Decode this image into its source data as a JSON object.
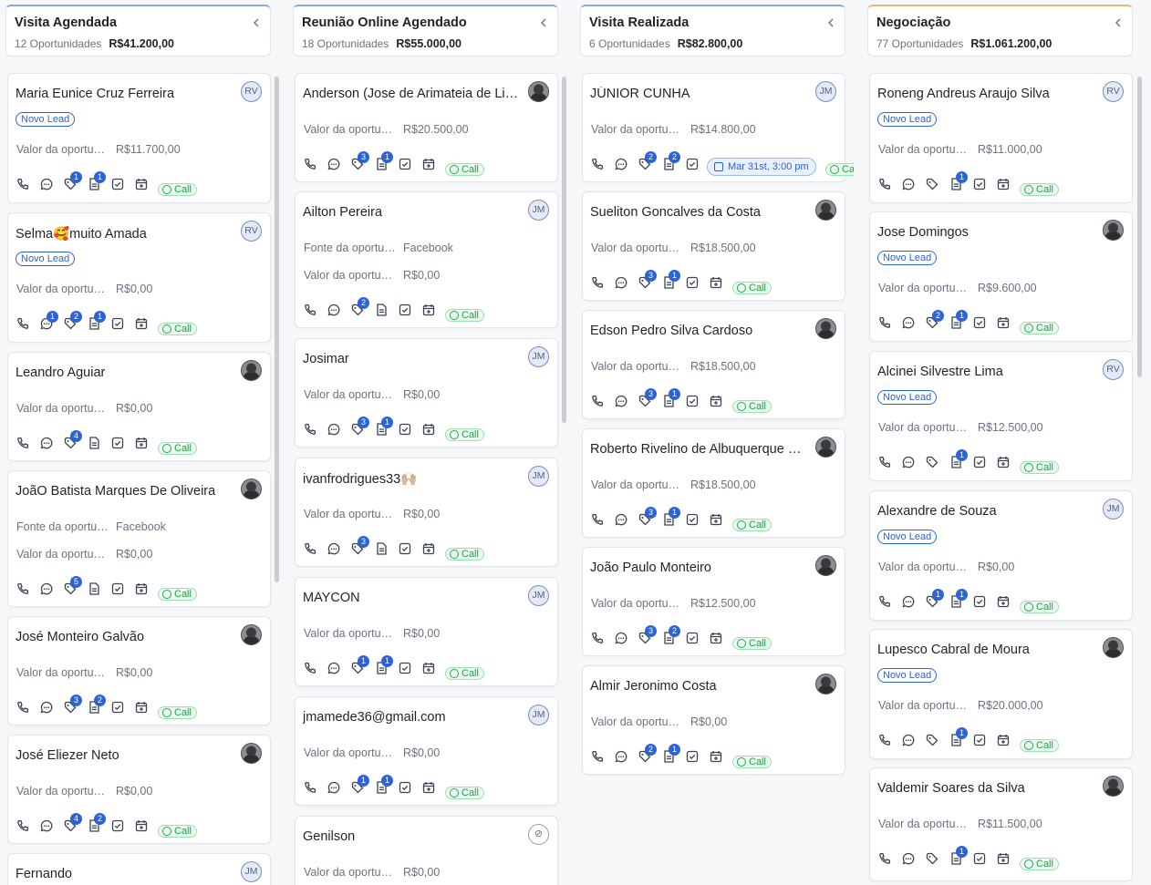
{
  "columns": [
    {
      "title": "Visita Agendada",
      "count": "12 Oportunidades",
      "total": "R$41.200,00",
      "cards": [
        {
          "name": "Maria Eunice Cruz Ferreira",
          "avatar": "RV",
          "badge": "Novo Lead",
          "fields": [
            {
              "label": "Valor da oportunidade",
              "value": "R$11.700,00"
            }
          ],
          "counts": [
            "",
            "",
            "1",
            "1",
            "",
            ""
          ],
          "call": "Call"
        },
        {
          "name": "Selma🥰muito Amada",
          "avatar": "RV",
          "badge": "Novo Lead",
          "fields": [
            {
              "label": "Valor da oportunidade",
              "value": "R$0,00"
            }
          ],
          "counts": [
            "",
            "1",
            "2",
            "1",
            "",
            ""
          ],
          "call": "Call"
        },
        {
          "name": "Leandro Aguiar",
          "avatar": "",
          "badge": "",
          "fields": [
            {
              "label": "Valor da oportunidade",
              "value": "R$0,00"
            }
          ],
          "counts": [
            "",
            "",
            "4",
            "",
            "",
            ""
          ],
          "call": "Call"
        },
        {
          "name": "JoãO Batista Marques De Oliveira",
          "avatar": "",
          "badge": "",
          "fields": [
            {
              "label": "Fonte da oportunidade",
              "value": "Facebook"
            },
            {
              "label": "Valor da oportunidade",
              "value": "R$0,00"
            }
          ],
          "counts": [
            "",
            "",
            "5",
            "",
            "",
            ""
          ],
          "call": "Call"
        },
        {
          "name": "José Monteiro Galvão",
          "avatar": "",
          "badge": "",
          "fields": [
            {
              "label": "Valor da oportunidade",
              "value": "R$0,00"
            }
          ],
          "counts": [
            "",
            "",
            "3",
            "2",
            "",
            ""
          ],
          "call": "Call"
        },
        {
          "name": "José Eliezer Neto",
          "avatar": "",
          "badge": "",
          "fields": [
            {
              "label": "Valor da oportunidade",
              "value": "R$0,00"
            }
          ],
          "counts": [
            "",
            "",
            "4",
            "2",
            "",
            ""
          ],
          "call": "Call"
        },
        {
          "name": "Fernando",
          "avatar": "JM",
          "badge": "",
          "fields": [],
          "counts": [],
          "call": ""
        }
      ]
    },
    {
      "title": "Reunião Online Agendado",
      "count": "18 Oportunidades",
      "total": "R$55.000,00",
      "cards": [
        {
          "name": "Anderson (Jose de Arimateia de Lima)",
          "avatar": "",
          "badge": "",
          "fields": [
            {
              "label": "Valor da oportunidade",
              "value": "R$20.500,00"
            }
          ],
          "counts": [
            "",
            "",
            "3",
            "1",
            "",
            ""
          ],
          "call": "Call"
        },
        {
          "name": "Ailton Pereira",
          "avatar": "JM",
          "badge": "",
          "fields": [
            {
              "label": "Fonte da oportunidade",
              "value": "Facebook"
            },
            {
              "label": "Valor da oportunidade",
              "value": "R$0,00"
            }
          ],
          "counts": [
            "",
            "",
            "2",
            "",
            "",
            ""
          ],
          "call": "Call"
        },
        {
          "name": "Josimar",
          "avatar": "JM",
          "badge": "",
          "fields": [
            {
              "label": "Valor da oportunidade",
              "value": "R$0,00"
            }
          ],
          "counts": [
            "",
            "",
            "3",
            "1",
            "",
            ""
          ],
          "call": "Call"
        },
        {
          "name": "ivanfrodrigues33🙌🏼",
          "avatar": "JM",
          "badge": "",
          "fields": [
            {
              "label": "Valor da oportunidade",
              "value": "R$0,00"
            }
          ],
          "counts": [
            "",
            "",
            "3",
            "",
            "",
            ""
          ],
          "call": "Call"
        },
        {
          "name": "MAYCON",
          "avatar": "JM",
          "badge": "",
          "fields": [
            {
              "label": "Valor da oportunidade",
              "value": "R$0,00"
            }
          ],
          "counts": [
            "",
            "",
            "1",
            "1",
            "",
            ""
          ],
          "call": "Call"
        },
        {
          "name": "jmamede36@gmail.com",
          "avatar": "JM",
          "badge": "",
          "fields": [
            {
              "label": "Valor da oportunidade",
              "value": "R$0,00"
            }
          ],
          "counts": [
            "",
            "",
            "1",
            "1",
            "",
            ""
          ],
          "call": "Call"
        },
        {
          "name": "Genilson",
          "avatar": "user-x",
          "badge": "",
          "fields": [
            {
              "label": "Valor da oportunidade",
              "value": "R$0,00"
            }
          ],
          "counts": [],
          "call": ""
        }
      ]
    },
    {
      "title": "Visita Realizada",
      "count": "6 Oportunidades",
      "total": "R$82.800,00",
      "cards": [
        {
          "name": "JÚNIOR CUNHA",
          "avatar": "JM",
          "badge": "",
          "fields": [
            {
              "label": "Valor da oportunidade",
              "value": "R$14.800,00"
            }
          ],
          "counts": [
            "",
            "",
            "2",
            "2",
            "",
            ""
          ],
          "date": "Mar 31st, 3:00 pm",
          "call": "Call"
        },
        {
          "name": "Sueliton Goncalves da Costa",
          "avatar": "",
          "badge": "",
          "fields": [
            {
              "label": "Valor da oportunidade",
              "value": "R$18.500,00"
            }
          ],
          "counts": [
            "",
            "",
            "3",
            "1",
            "",
            ""
          ],
          "call": "Call"
        },
        {
          "name": "Edson Pedro Silva Cardoso",
          "avatar": "",
          "badge": "",
          "fields": [
            {
              "label": "Valor da oportunidade",
              "value": "R$18.500,00"
            }
          ],
          "counts": [
            "",
            "",
            "3",
            "1",
            "",
            ""
          ],
          "call": "Call"
        },
        {
          "name": "Roberto Rivelino de Albuquerque Cavalcanti",
          "avatar": "",
          "badge": "",
          "fields": [
            {
              "label": "Valor da oportunidade",
              "value": "R$18.500,00"
            }
          ],
          "counts": [
            "",
            "",
            "3",
            "1",
            "",
            ""
          ],
          "call": "Call"
        },
        {
          "name": "João Paulo Monteiro",
          "avatar": "",
          "badge": "",
          "fields": [
            {
              "label": "Valor da oportunidade",
              "value": "R$12.500,00"
            }
          ],
          "counts": [
            "",
            "",
            "3",
            "2",
            "",
            ""
          ],
          "call": "Call"
        },
        {
          "name": "Almir Jeronimo Costa",
          "avatar": "",
          "badge": "",
          "fields": [
            {
              "label": "Valor da oportunidade",
              "value": "R$0,00"
            }
          ],
          "counts": [
            "",
            "",
            "2",
            "1",
            "",
            ""
          ],
          "call": "Call"
        }
      ]
    },
    {
      "title": "Negociação",
      "count": "77 Oportunidades",
      "total": "R$1.061.200,00",
      "cards": [
        {
          "name": "Roneng Andreus Araujo Silva",
          "avatar": "RV",
          "badge": "Novo Lead",
          "fields": [
            {
              "label": "Valor da oportunidade",
              "value": "R$11.000,00"
            }
          ],
          "counts": [
            "",
            "",
            "",
            "1",
            "",
            ""
          ],
          "call": "Call"
        },
        {
          "name": "Jose Domingos",
          "avatar": "",
          "badge": "Novo Lead",
          "fields": [
            {
              "label": "Valor da oportunidade",
              "value": "R$9.600,00"
            }
          ],
          "counts": [
            "",
            "",
            "2",
            "1",
            "",
            ""
          ],
          "call": "Call"
        },
        {
          "name": "Alcinei Silvestre Lima",
          "avatar": "RV",
          "badge": "Novo Lead",
          "fields": [
            {
              "label": "Valor da oportunidade",
              "value": "R$12.500,00"
            }
          ],
          "counts": [
            "",
            "",
            "",
            "1",
            "",
            ""
          ],
          "call": "Call"
        },
        {
          "name": "Alexandre de Souza",
          "avatar": "JM",
          "badge": "Novo Lead",
          "fields": [
            {
              "label": "Valor da oportunidade",
              "value": "R$0,00"
            }
          ],
          "counts": [
            "",
            "",
            "1",
            "1",
            "",
            ""
          ],
          "call": "Call"
        },
        {
          "name": "Lupesco Cabral de Moura",
          "avatar": "",
          "badge": "Novo Lead",
          "fields": [
            {
              "label": "Valor da oportunidade",
              "value": "R$20.000,00"
            }
          ],
          "counts": [
            "",
            "",
            "",
            "1",
            "",
            ""
          ],
          "call": "Call"
        },
        {
          "name": "Valdemir Soares da Silva",
          "avatar": "",
          "badge": "",
          "fields": [
            {
              "label": "Valor da oportunidade",
              "value": "R$11.500,00"
            }
          ],
          "counts": [
            "",
            "",
            "",
            "1",
            "",
            ""
          ],
          "call": "Call"
        }
      ]
    }
  ],
  "icons": [
    "phone-icon",
    "chat-icon",
    "tag-icon",
    "note-icon",
    "task-icon",
    "calendar-add-icon"
  ],
  "colors": {
    "accent": "#2c63d8",
    "call_green": "#1e9e4a",
    "header_top_blue": "#8aa7f0",
    "header_top_orange": "#f2b07a"
  }
}
